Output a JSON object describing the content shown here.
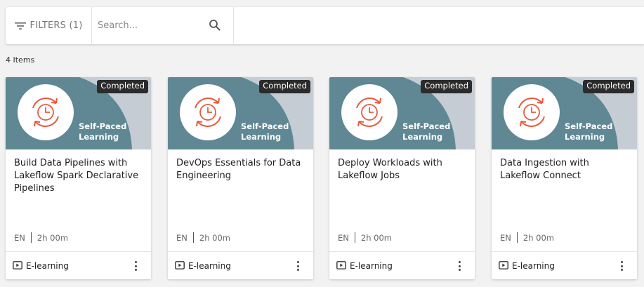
{
  "toolbar": {
    "filters_label": "FILTERS (1)",
    "filters_icon": "filter-lines-icon",
    "search_placeholder": "Search...",
    "search_value": "",
    "search_icon": "search-icon"
  },
  "results": {
    "count_label": "4 Items"
  },
  "colors": {
    "thumb_teal": "#5f8794",
    "thumb_light": "#c5ccd3",
    "icon_orange": "#e8593d",
    "badge_bg": "#2b2b2b"
  },
  "cards": [
    {
      "badge": "Completed",
      "thumb_line1": "Self-Paced",
      "thumb_line2": "Learning",
      "title": "Build Data Pipelines with Lakeflow Spark Declarative Pipelines",
      "language": "EN",
      "duration": "2h 00m",
      "type_icon": "video-play-icon",
      "type": "E-learning"
    },
    {
      "badge": "Completed",
      "thumb_line1": "Self-Paced",
      "thumb_line2": "Learning",
      "title": "DevOps Essentials for Data Engineering",
      "language": "EN",
      "duration": "2h 00m",
      "type_icon": "video-play-icon",
      "type": "E-learning"
    },
    {
      "badge": "Completed",
      "thumb_line1": "Self-Paced",
      "thumb_line2": "Learning",
      "title": "Deploy Workloads with Lakeflow Jobs",
      "language": "EN",
      "duration": "2h 00m",
      "type_icon": "video-play-icon",
      "type": "E-learning"
    },
    {
      "badge": "Completed",
      "thumb_line1": "Self-Paced",
      "thumb_line2": "Learning",
      "title": "Data Ingestion with Lakeflow Connect",
      "language": "EN",
      "duration": "2h 00m",
      "type_icon": "video-play-icon",
      "type": "E-learning"
    }
  ]
}
